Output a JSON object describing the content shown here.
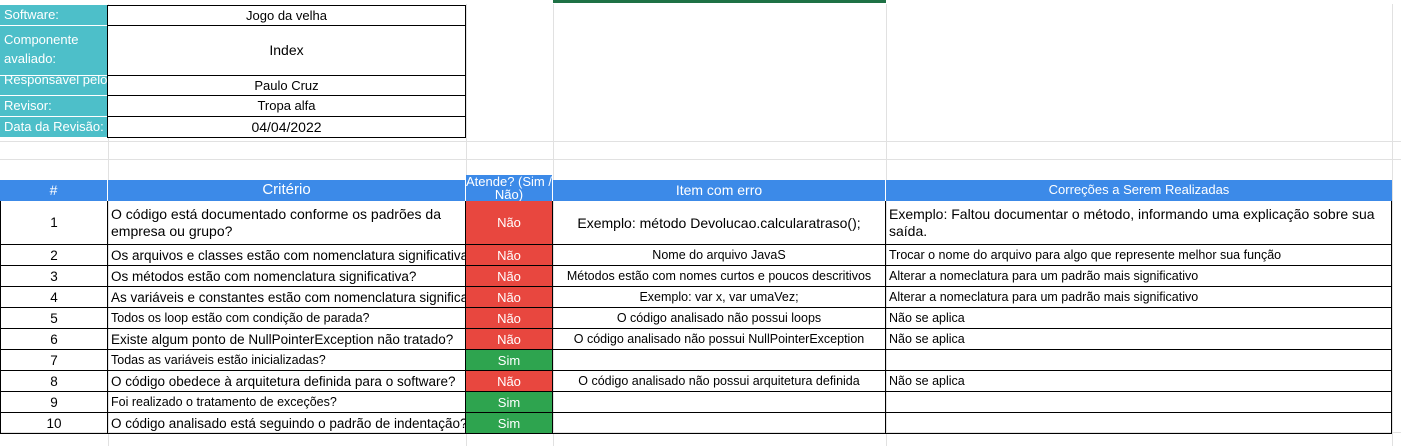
{
  "sheet_colors": {
    "label_bg": "#4dbfc9",
    "header_bg": "#3c8ae8",
    "ok": "#2ea44f",
    "no": "#e8473f"
  },
  "info": [
    {
      "label": "Software:",
      "value": "Jogo da velha"
    },
    {
      "label": "Componente avaliado:",
      "value": "Index"
    },
    {
      "label": "Responsável pelo",
      "value": "Paulo Cruz"
    },
    {
      "label": "Revisor:",
      "value": "Tropa alfa"
    },
    {
      "label": "Data da Revisão:",
      "value": "04/04/2022"
    }
  ],
  "table": {
    "headers": [
      "#",
      "Critério",
      "Atende? (Sim / Não)",
      "Item com erro",
      "Correções a Serem Realizadas"
    ],
    "rows": [
      {
        "num": "1",
        "criterio": "O código está documentado conforme os padrões da empresa ou grupo?",
        "atende": "Não",
        "item": "Exemplo: método Devolucao.calcularatraso();",
        "correcao": "Exemplo: Faltou documentar o método, informando uma explicação sobre sua saída."
      },
      {
        "num": "2",
        "criterio": "Os arquivos e classes estão com nomenclatura significativa?",
        "atende": "Não",
        "item": "Nome do arquivo JavaS",
        "correcao": "Trocar o nome do arquivo para algo que represente melhor sua função"
      },
      {
        "num": "3",
        "criterio": "Os métodos estão com nomenclatura significativa?",
        "atende": "Não",
        "item": "Métodos estão com nomes curtos e poucos descritivos",
        "correcao": "Alterar a nomeclatura para um padrão mais significativo"
      },
      {
        "num": "4",
        "criterio": "As variáveis e constantes estão com nomenclatura significativa?",
        "atende": "Não",
        "item": "Exemplo: var x, var umaVez;",
        "correcao": "Alterar a nomeclatura para um padrão mais significativo"
      },
      {
        "num": "5",
        "criterio": "Todos os loop estão com condição de parada?",
        "atende": "Não",
        "item": "O código analisado não possui loops",
        "correcao": "Não se aplica"
      },
      {
        "num": "6",
        "criterio": "Existe algum ponto de NullPointerException não tratado?",
        "atende": "Não",
        "item": "O código analisado não possui NullPointerException",
        "correcao": "Não se aplica"
      },
      {
        "num": "7",
        "criterio": "Todas as variáveis estão inicializadas?",
        "atende": "Sim",
        "item": "",
        "correcao": ""
      },
      {
        "num": "8",
        "criterio": "O código obedece à arquitetura definida para o software?",
        "atende": "Não",
        "item": "O código analisado não possui arquitetura definida",
        "correcao": "Não se aplica"
      },
      {
        "num": "9",
        "criterio": "Foi realizado o tratamento de exceções?",
        "atende": "Sim",
        "item": "",
        "correcao": ""
      },
      {
        "num": "10",
        "criterio": "O código analisado está seguindo o padrão de indentação?",
        "atende": "Sim",
        "item": "",
        "correcao": ""
      }
    ]
  }
}
